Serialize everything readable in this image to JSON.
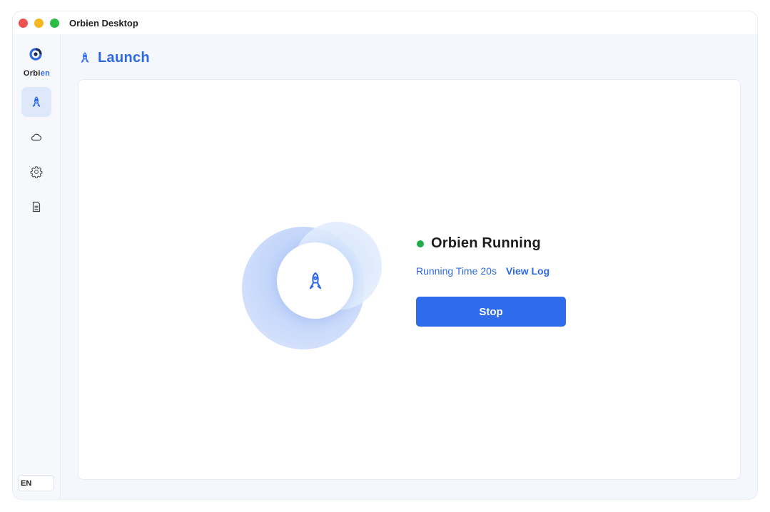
{
  "window": {
    "title": "Orbien Desktop"
  },
  "brand": {
    "name_prefix": "Orbi",
    "name_accent": "en",
    "accent_color": "#2e68e8"
  },
  "sidebar": {
    "items": [
      {
        "id": "launch",
        "icon": "rocket-icon",
        "active": true
      },
      {
        "id": "cloud",
        "icon": "cloud-icon",
        "active": false
      },
      {
        "id": "settings",
        "icon": "gear-icon",
        "active": false
      },
      {
        "id": "docs",
        "icon": "document-icon",
        "active": false
      }
    ],
    "language": "EN"
  },
  "page": {
    "title": "Launch"
  },
  "status": {
    "text": "Orbien Running",
    "dot_color": "#1fae4b",
    "running_label": "Running Time",
    "running_value": "20s",
    "view_log_label": "View Log",
    "stop_label": "Stop"
  }
}
